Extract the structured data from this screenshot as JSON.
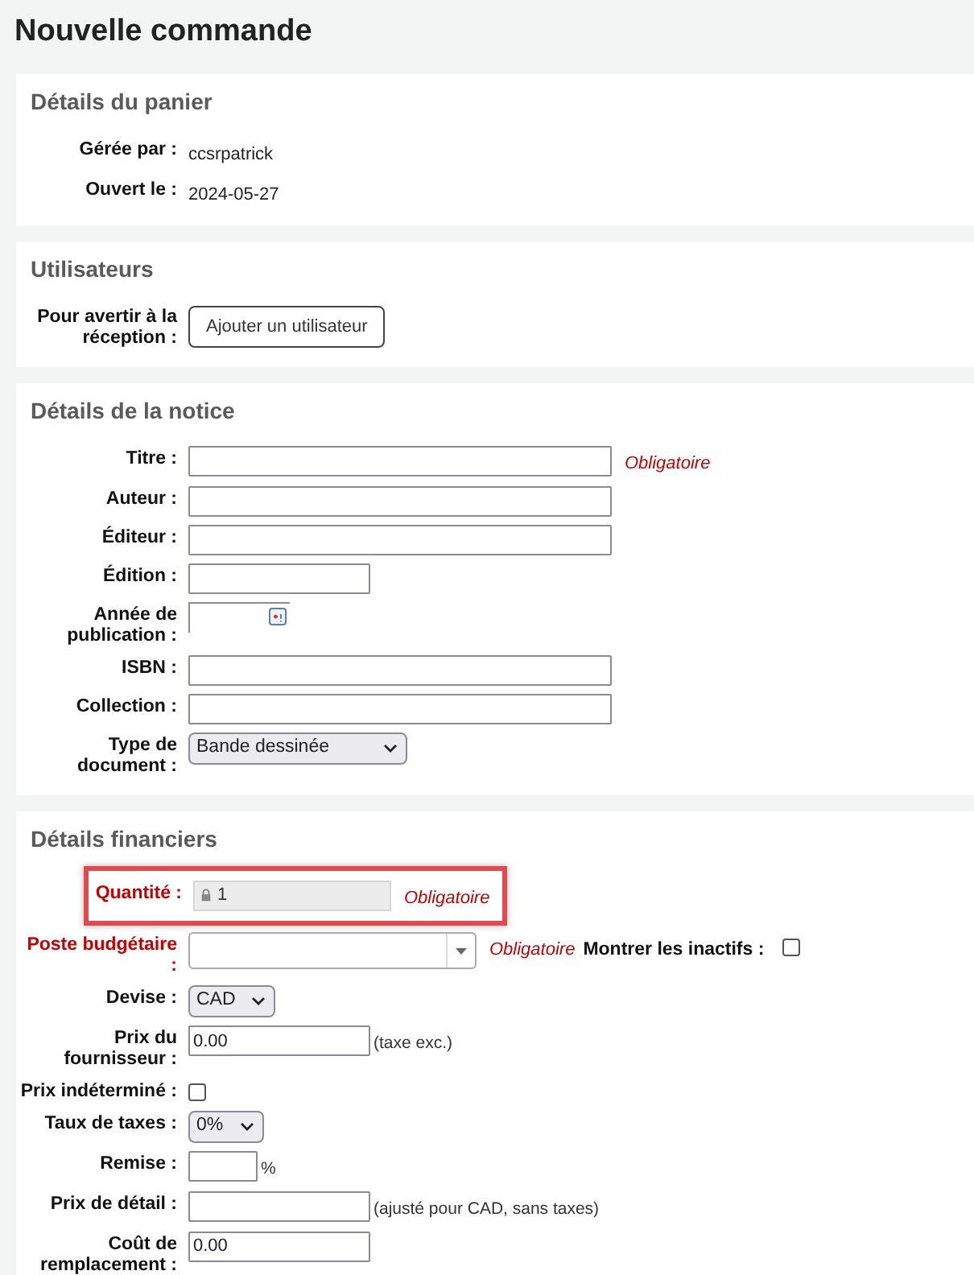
{
  "page_title": "Nouvelle commande",
  "sections": [
    {
      "title": "Détails du panier",
      "rows": [
        {
          "kind": "static",
          "label": "Gérée par :",
          "value": "ccsrpatrick"
        },
        {
          "kind": "static",
          "label": "Ouvert le :",
          "value": "2024-05-27"
        }
      ]
    },
    {
      "title": "Utilisateurs",
      "rows": [
        {
          "kind": "button",
          "label": "Pour avertir à la réception :",
          "value": "Ajouter un utilisateur"
        }
      ]
    },
    {
      "title": "Détails de la notice",
      "rows": [
        {
          "kind": "long",
          "label": "Titre :",
          "required_note": "Obligatoire"
        },
        {
          "kind": "long",
          "label": "Auteur :"
        },
        {
          "kind": "long",
          "label": "Éditeur :"
        },
        {
          "kind": "short",
          "label": "Édition :"
        },
        {
          "kind": "date",
          "label": "Année de publication :"
        },
        {
          "kind": "long",
          "label": "ISBN :"
        },
        {
          "kind": "long",
          "label": "Collection :"
        },
        {
          "kind": "select",
          "label": "Type de document :",
          "value": "Bande dessinée"
        }
      ]
    },
    {
      "title": "Détails financiers",
      "rows": [
        {
          "kind": "readonly",
          "label": "Quantité :",
          "required": true,
          "highlighted": true,
          "value": "1",
          "required_note": "Obligatoire"
        },
        {
          "kind": "combo",
          "label": "Poste budgétaire :",
          "required": true,
          "required_note": "Obligatoire",
          "extra_label": "Montrer les inactifs :",
          "extra_checked": false
        },
        {
          "kind": "select",
          "label": "Devise :",
          "value": "CAD"
        },
        {
          "kind": "short",
          "label": "Prix du fournisseur :",
          "value": "0.00",
          "note": "(taxe exc.)"
        },
        {
          "kind": "checkbox",
          "label": "Prix indéterminé :",
          "checked": false
        },
        {
          "kind": "select",
          "label": "Taux de taxes :",
          "value": "0%"
        },
        {
          "kind": "tiny",
          "label": "Remise :",
          "note": "%"
        },
        {
          "kind": "short",
          "label": "Prix de détail :",
          "note": "(ajusté pour CAD, sans taxes)"
        },
        {
          "kind": "short",
          "label": "Coût de remplacement :",
          "value": "0.00"
        }
      ]
    }
  ]
}
